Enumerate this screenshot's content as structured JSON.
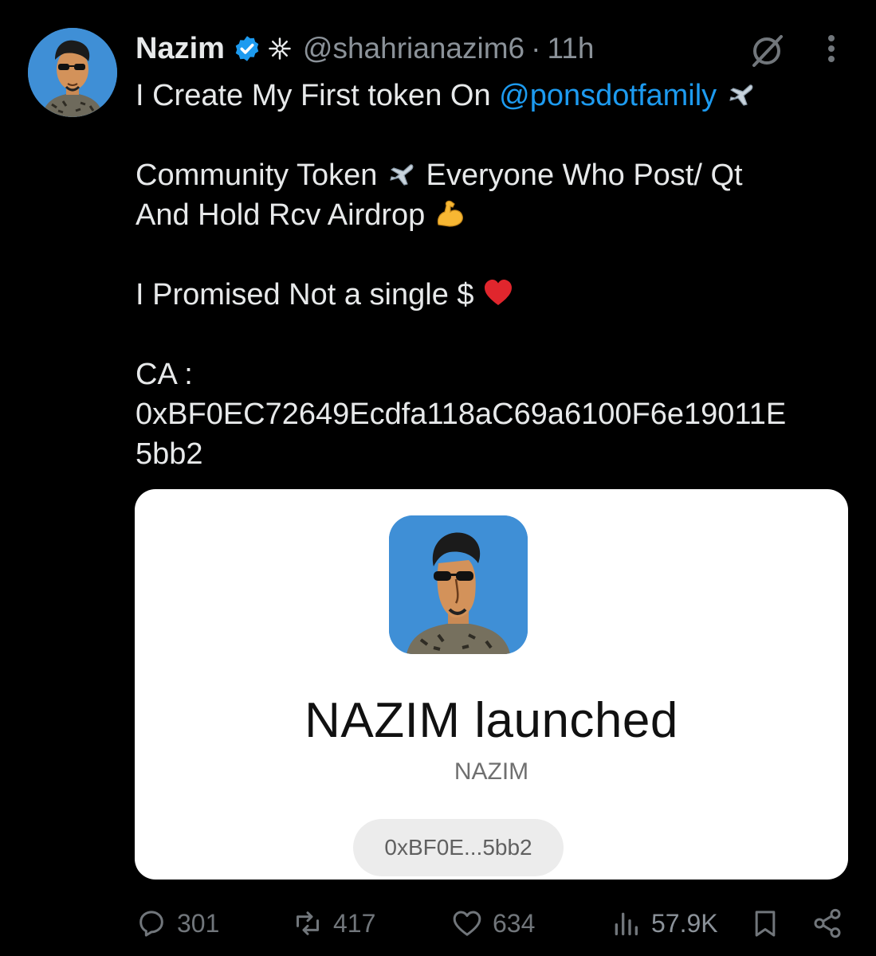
{
  "author": {
    "name": "Nazim",
    "handle": "@shahrianazim6",
    "separator": "·",
    "time": "11h"
  },
  "icons": {
    "verified": "verified-badge-icon",
    "affiliate": "sparkle-affiliate-icon",
    "grok": "grok-icon",
    "more": "more-dots-icon",
    "airplane": "airplane-emoji",
    "muscle": "flexed-biceps-emoji",
    "heart": "red-heart-emoji"
  },
  "tweet": {
    "line1_text": "I Create My First token On ",
    "line1_mention": "@ponsdotfamily",
    "para2_a": "Community Token ",
    "para2_b": " Everyone Who Post/ Qt",
    "para2_c": "And Hold Rcv Airdrop ",
    "para3": "I Promised Not a single $ ",
    "ca_label": "CA :",
    "ca_line1": "0xBF0EC72649Ecdfa118aC69a6100F6e19011E",
    "ca_line2": "5bb2"
  },
  "card": {
    "title": "NAZIM launched",
    "symbol": "NAZIM",
    "address_short": "0xBF0E...5bb2"
  },
  "actions": {
    "replies": "301",
    "reposts": "417",
    "likes": "634",
    "views": "57.9K"
  },
  "colors": {
    "background": "#000000",
    "text": "#e7e9ea",
    "muted": "#71767b",
    "link": "#1d9bf0",
    "verified": "#1d9bf0",
    "avatar_bg": "#3f8fd6",
    "card_bg": "#ffffff"
  }
}
